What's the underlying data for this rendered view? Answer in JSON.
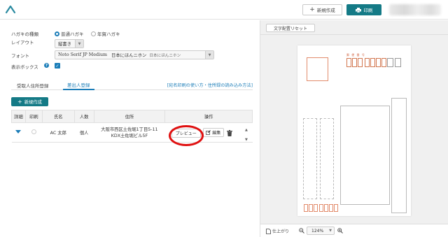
{
  "header": {
    "new_button_label": "新規作成",
    "print_button_label": "印刷"
  },
  "form": {
    "type_label": "ハガキの種類",
    "type_options": [
      "普通ハガキ",
      "年賀ハガキ"
    ],
    "type_selected": "普通ハガキ",
    "layout_label": "レイアウト",
    "layout_value": "縦書き",
    "font_label": "フォント",
    "font_value": "Noto Serif JP Medium",
    "font_sample_1": "日本にほんニホン",
    "font_sample_2": "日本にほんニホン",
    "show_box_label": "表示ボックス",
    "show_box_checked": true
  },
  "tabs": {
    "items": [
      "受取人住所登録",
      "差出人登録"
    ],
    "active": "差出人登録",
    "help_link": "[宛名印刷の使い方・住所録の読み込み方法]"
  },
  "create_button_label": "新規作成",
  "table": {
    "headers": [
      "詳細",
      "印刷",
      "氏名",
      "人数",
      "住所",
      "操作"
    ],
    "rows": [
      {
        "name": "AC 太郎",
        "count": "個人",
        "address_line1": "大阪市西区土佐堀1丁目5-11",
        "address_line2": "KDX土佐堀ビル5F",
        "preview_label": "プレビュー",
        "edit_label": "編集"
      }
    ]
  },
  "preview": {
    "reset_button_label": "文字配置リセット",
    "card_zip_label": "郵 便 番 号",
    "finish_label": "仕上がり",
    "zoom_value": "124%"
  },
  "colors": {
    "accent": "#147a86",
    "link": "#1b7db8",
    "annotation": "#e01010"
  }
}
